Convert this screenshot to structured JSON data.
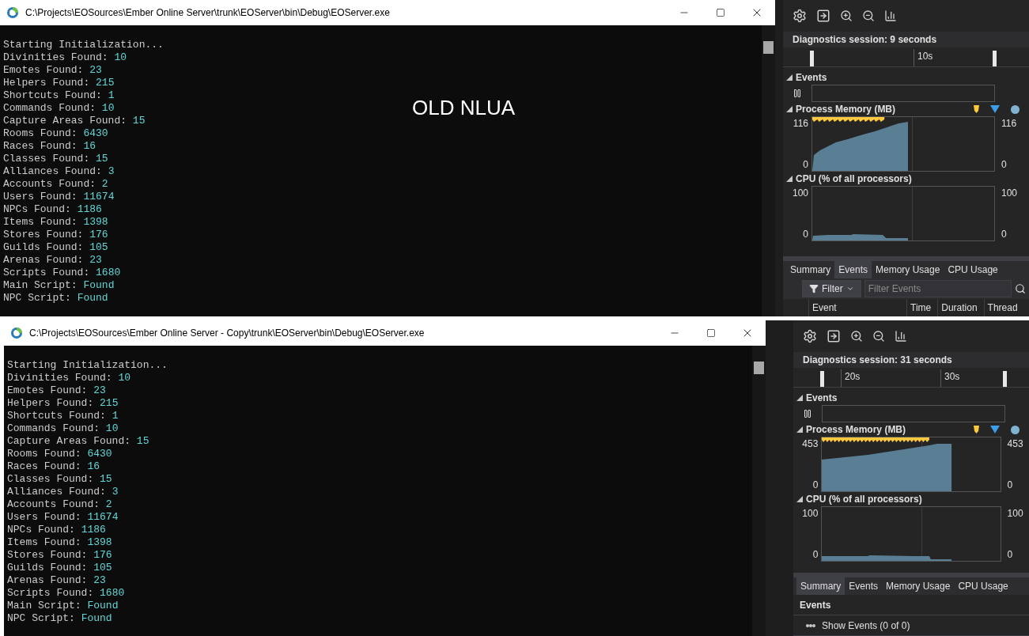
{
  "windows": [
    {
      "title": "C:\\Projects\\EOSources\\Ember Online Server\\trunk\\EOServer\\bin\\Debug\\EOServer.exe",
      "overlay": "OLD NLUA",
      "lines": [
        {
          "label": "Starting Initialization..."
        },
        {
          "label": "Divinities Found: ",
          "value": "10"
        },
        {
          "label": "Emotes Found: ",
          "value": "23"
        },
        {
          "label": "Helpers Found: ",
          "value": "215"
        },
        {
          "label": "Shortcuts Found: ",
          "value": "1"
        },
        {
          "label": "Commands Found: ",
          "value": "10"
        },
        {
          "label": "Capture Areas Found: ",
          "value": "15"
        },
        {
          "label": "Rooms Found: ",
          "value": "6430"
        },
        {
          "label": "Races Found: ",
          "value": "16"
        },
        {
          "label": "Classes Found: ",
          "value": "15"
        },
        {
          "label": "Alliances Found: ",
          "value": "3"
        },
        {
          "label": "Accounts Found: ",
          "value": "2"
        },
        {
          "label": "Users Found: ",
          "value": "11674"
        },
        {
          "label": "NPCs Found: ",
          "value": "1186"
        },
        {
          "label": "Items Found: ",
          "value": "1398"
        },
        {
          "label": "Stores Found: ",
          "value": "176"
        },
        {
          "label": "Guilds Found: ",
          "value": "105"
        },
        {
          "label": "Arenas Found: ",
          "value": "23"
        },
        {
          "label": "Scripts Found: ",
          "value": "1680"
        },
        {
          "label": "Main Script: ",
          "value": "Found"
        },
        {
          "label": "NPC Script: ",
          "value": "Found"
        }
      ],
      "diagnostics": {
        "session": "Diagnostics session: 9 seconds",
        "timeline": [
          "10s"
        ],
        "events_heading": "Events",
        "memory": {
          "title": "Process Memory (MB)",
          "left_max": "116",
          "left_min": "0",
          "right_max": "116",
          "right_min": "0"
        },
        "cpu": {
          "title": "CPU (% of all processors)",
          "left_max": "100",
          "left_min": "0",
          "right_max": "100",
          "right_min": "0"
        },
        "tabs": [
          {
            "label": "Summary",
            "selected": false
          },
          {
            "label": "Events",
            "selected": true
          },
          {
            "label": "Memory Usage",
            "selected": false
          },
          {
            "label": "CPU Usage",
            "selected": false
          }
        ],
        "bottom": {
          "kind": "events_table",
          "filter": "Filter",
          "placeholder": "Filter Events",
          "columns": [
            "Event",
            "Time",
            "Duration",
            "Thread"
          ]
        }
      }
    },
    {
      "title": "C:\\Projects\\EOSources\\Ember Online Server - Copy\\trunk\\EOServer\\bin\\Debug\\EOServer.exe",
      "lines": [
        {
          "label": "Starting Initialization..."
        },
        {
          "label": "Divinities Found: ",
          "value": "10"
        },
        {
          "label": "Emotes Found: ",
          "value": "23"
        },
        {
          "label": "Helpers Found: ",
          "value": "215"
        },
        {
          "label": "Shortcuts Found: ",
          "value": "1"
        },
        {
          "label": "Commands Found: ",
          "value": "10"
        },
        {
          "label": "Capture Areas Found: ",
          "value": "15"
        },
        {
          "label": "Rooms Found: ",
          "value": "6430"
        },
        {
          "label": "Races Found: ",
          "value": "16"
        },
        {
          "label": "Classes Found: ",
          "value": "15"
        },
        {
          "label": "Alliances Found: ",
          "value": "3"
        },
        {
          "label": "Accounts Found: ",
          "value": "2"
        },
        {
          "label": "Users Found: ",
          "value": "11674"
        },
        {
          "label": "NPCs Found: ",
          "value": "1186"
        },
        {
          "label": "Items Found: ",
          "value": "1398"
        },
        {
          "label": "Stores Found: ",
          "value": "176"
        },
        {
          "label": "Guilds Found: ",
          "value": "105"
        },
        {
          "label": "Arenas Found: ",
          "value": "23"
        },
        {
          "label": "Scripts Found: ",
          "value": "1680"
        },
        {
          "label": "Main Script: ",
          "value": "Found"
        },
        {
          "label": "NPC Script: ",
          "value": "Found"
        }
      ],
      "diagnostics": {
        "session": "Diagnostics session: 31 seconds",
        "timeline": [
          "20s",
          "30s"
        ],
        "events_heading": "Events",
        "memory": {
          "title": "Process Memory (MB)",
          "left_max": "453",
          "left_min": "0",
          "right_max": "453",
          "right_min": "0"
        },
        "cpu": {
          "title": "CPU (% of all processors)",
          "left_max": "100",
          "left_min": "0",
          "right_max": "100",
          "right_min": "0"
        },
        "tabs": [
          {
            "label": "Summary",
            "selected": true
          },
          {
            "label": "Events",
            "selected": false
          },
          {
            "label": "Memory Usage",
            "selected": false
          },
          {
            "label": "CPU Usage",
            "selected": false
          }
        ],
        "bottom": {
          "kind": "summary",
          "heading": "Events",
          "link": "Show Events (0 of 0)"
        }
      }
    }
  ]
}
